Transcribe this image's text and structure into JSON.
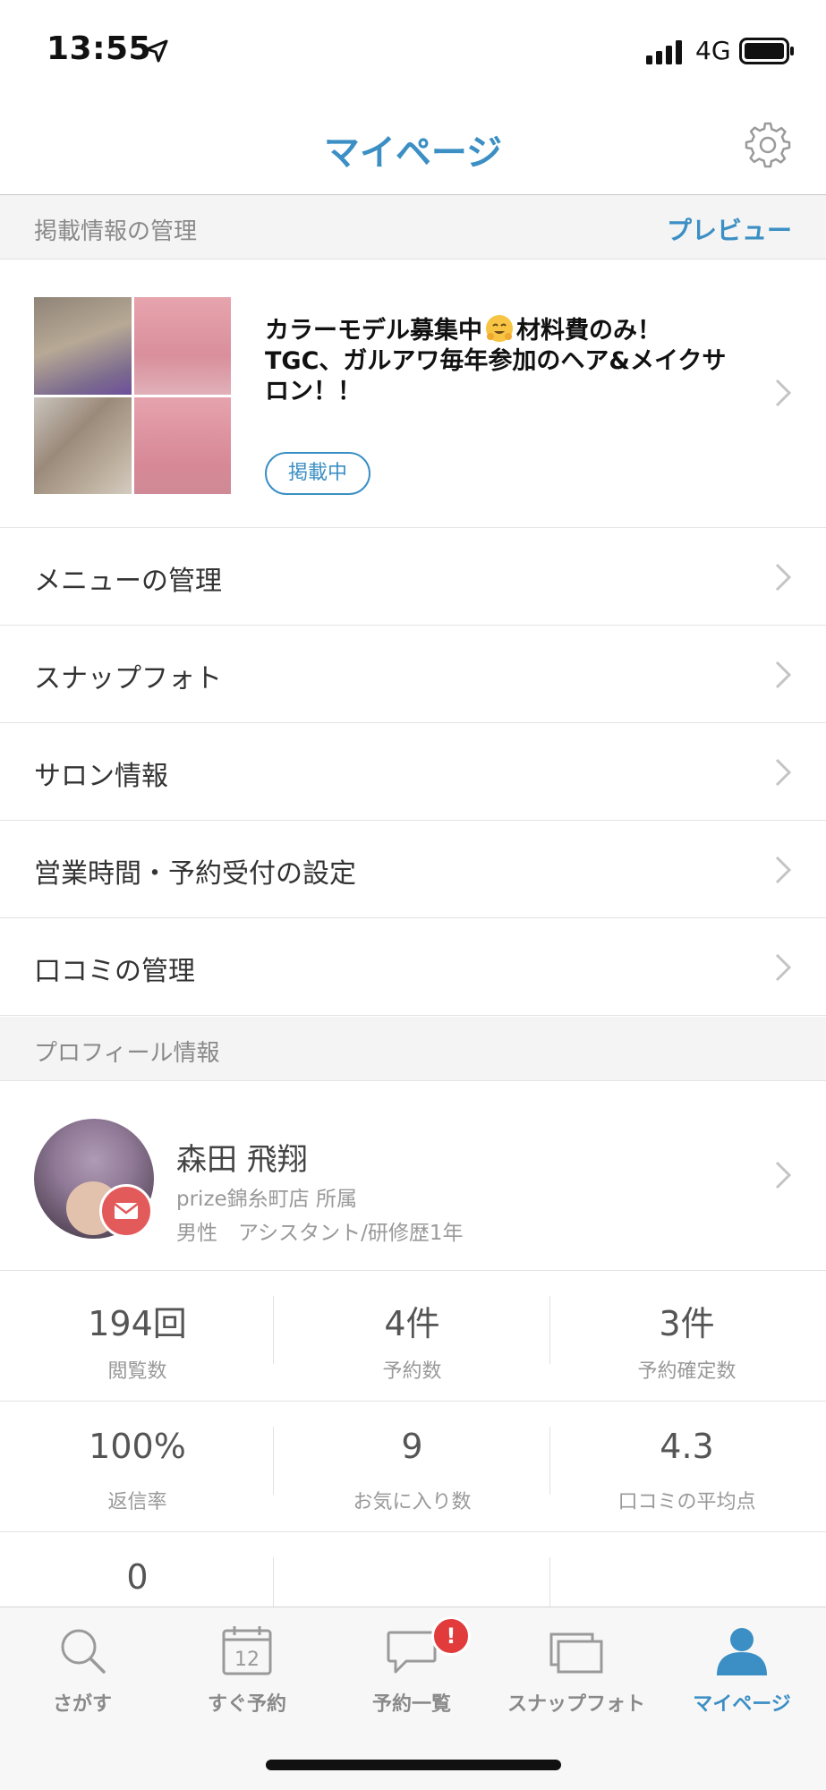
{
  "status_bar": {
    "time": "13:55",
    "network": "4G"
  },
  "header": {
    "title": "マイページ",
    "settings_icon": "gear-icon"
  },
  "listing_section": {
    "title": "掲載情報の管理",
    "preview_label": "プレビュー"
  },
  "listing": {
    "title_line1_a": "カラーモデル募集中",
    "title_emoji": "hugging-face-icon",
    "title_line1_b": "材料費のみ！",
    "title_line2": "TGC、ガルアワ毎年参加のヘア&メイクサ",
    "title_line3": "ロン！！",
    "status": "掲載中"
  },
  "menu": {
    "items": [
      {
        "label": "メニューの管理"
      },
      {
        "label": "スナップフォト"
      },
      {
        "label": "サロン情報"
      },
      {
        "label": "営業時間・予約受付の設定"
      },
      {
        "label": "口コミの管理"
      }
    ]
  },
  "profile_section": {
    "title": "プロフィール情報"
  },
  "profile": {
    "name": "森田 飛翔",
    "salon": "prize錦糸町店 所属",
    "meta": "男性　アシスタント/研修歴1年"
  },
  "stats": {
    "row1": [
      {
        "value": "194回",
        "label": "閲覧数"
      },
      {
        "value": "4件",
        "label": "予約数"
      },
      {
        "value": "3件",
        "label": "予約確定数"
      }
    ],
    "row2": [
      {
        "value": "100%",
        "label": "返信率"
      },
      {
        "value": "9",
        "label": "お気に入り数"
      },
      {
        "value": "4.3",
        "label": "口コミの平均点"
      }
    ],
    "row3": [
      {
        "value": "0",
        "label": ""
      }
    ]
  },
  "tab_bar": {
    "tabs": [
      {
        "label": "さがす",
        "icon": "search-icon"
      },
      {
        "label": "すぐ予約",
        "icon": "calendar-icon",
        "calendar_day": "12"
      },
      {
        "label": "予約一覧",
        "icon": "chat-bubble-icon",
        "badge": "!"
      },
      {
        "label": "スナップフォト",
        "icon": "photos-icon"
      },
      {
        "label": "マイページ",
        "icon": "person-icon",
        "active": true
      }
    ]
  },
  "colors": {
    "accent": "#3b8fc4",
    "badge_red": "#e23b3b",
    "mail_badge": "#e35a5a"
  }
}
